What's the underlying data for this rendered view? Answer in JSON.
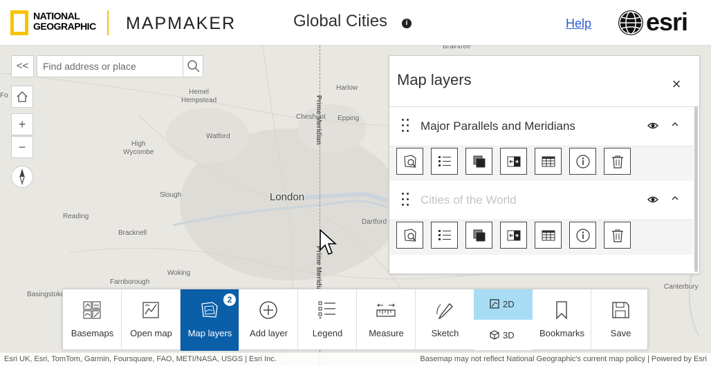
{
  "header": {
    "brand_line1": "NATIONAL",
    "brand_line2": "GEOGRAPHIC",
    "app_name": "MAPMAKER",
    "map_title": "Global Cities",
    "info_glyph": "i",
    "help_label": "Help",
    "partner_logo": "esri"
  },
  "map": {
    "search_placeholder": "Find address or place",
    "collapse_glyph": "<<",
    "zoom_in": "+",
    "zoom_out": "−",
    "places": {
      "braintree": "Braintree",
      "harlow": "Harlow",
      "hemel": "Hemel\nHempstead",
      "cheshunt": "Cheshunt",
      "epping": "Epping",
      "watford": "Watford",
      "high_wycombe": "High\nWycombe",
      "slough": "Slough",
      "london": "London",
      "reading": "Reading",
      "bracknell": "Bracknell",
      "dartford": "Dartford",
      "woking": "Woking",
      "farnborough": "Farnborough",
      "basingstoke": "Basingstoke",
      "canterbury": "Canterbury",
      "fo": "Fo"
    },
    "meridian_label": "Prime Meridian"
  },
  "layers_panel": {
    "title": "Map layers",
    "close_glyph": "×",
    "layers": [
      {
        "name": "Major Parallels and Meridians",
        "visible": true,
        "dimmed": false
      },
      {
        "name": "Cities of the World",
        "visible": true,
        "dimmed": true
      }
    ],
    "tool_icons": [
      "zoom-to-icon",
      "legend-icon",
      "transparency-icon",
      "swipe-icon",
      "table-icon",
      "info-icon",
      "delete-icon"
    ]
  },
  "toolbar": {
    "basemaps": "Basemaps",
    "open_map": "Open map",
    "map_layers": "Map layers",
    "map_layers_count": "2",
    "add_layer": "Add layer",
    "legend": "Legend",
    "measure": "Measure",
    "sketch": "Sketch",
    "dim_2d": "2D",
    "dim_3d": "3D",
    "bookmarks": "Bookmarks",
    "save": "Save",
    "active_color": "#0b5fa9",
    "selected_dim_color": "#a8dcf5"
  },
  "attribution": {
    "left": "Esri UK, Esri, TomTom, Garmin, Foursquare, FAO, METI/NASA, USGS | Esri Inc.",
    "right": "Basemap may not reflect National Geographic's current map policy | Powered by Esri"
  }
}
